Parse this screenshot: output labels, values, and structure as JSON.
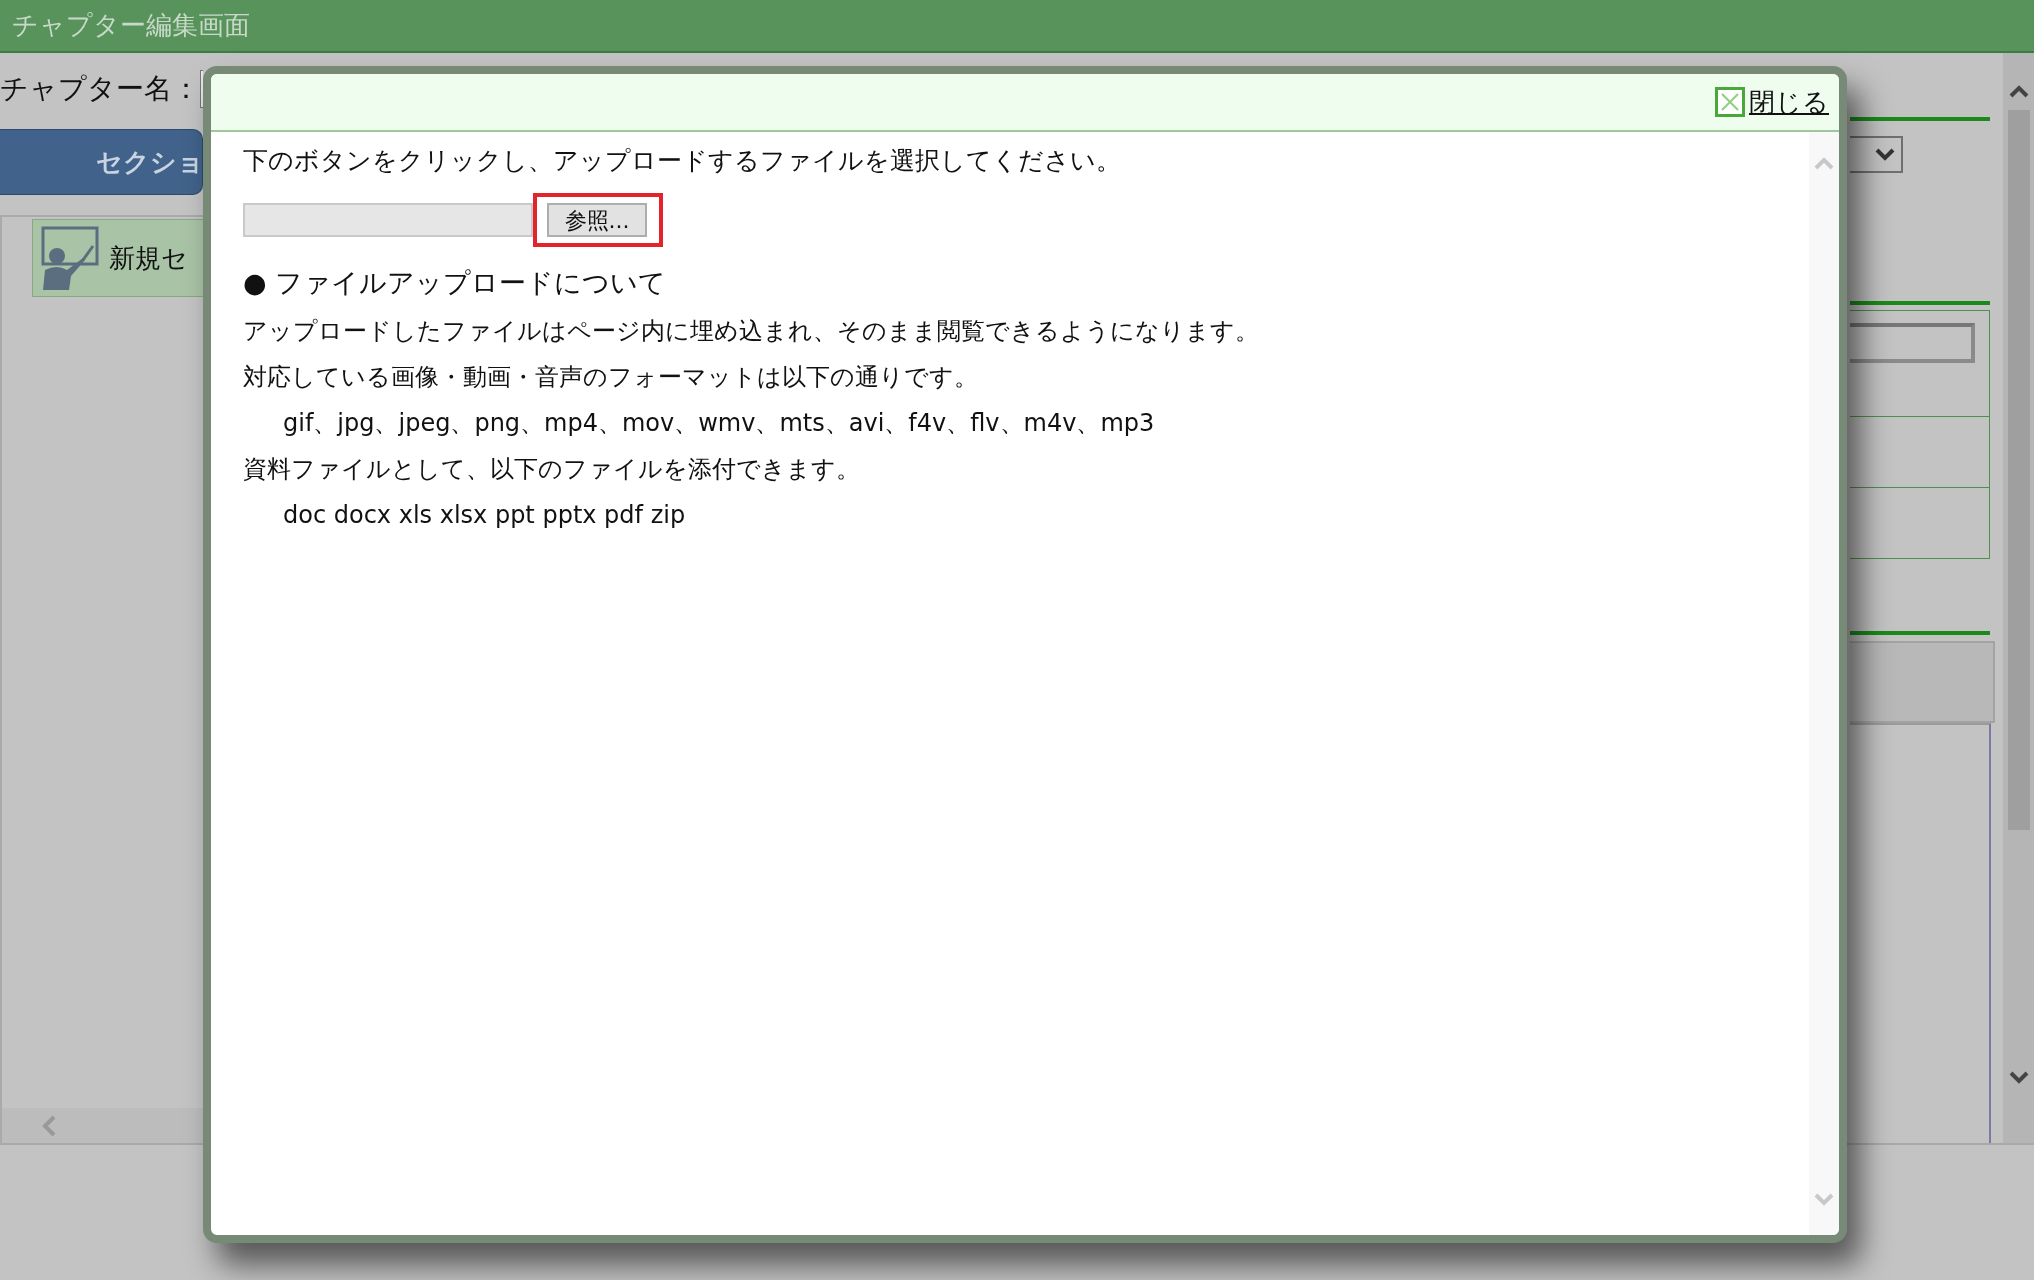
{
  "header": {
    "title": "チャプター編集画面"
  },
  "chapter_name": {
    "label": "チャプター名："
  },
  "section_button": {
    "label": "セクショ"
  },
  "section_items": [
    {
      "label": "新規セ"
    }
  ],
  "dialog": {
    "close_link": "閉じる",
    "instruction": "下のボタンをクリックし、アップロードするファイルを選択してください。",
    "file_field": {
      "button": "参照...",
      "highlighted": true
    },
    "about_heading": "● ファイルアップロードについて",
    "paragraphs": [
      {
        "kind": "text",
        "text": "アップロードしたファイルはページ内に埋め込まれ、そのまま閲覧できるようになります。"
      },
      {
        "kind": "text",
        "text": "対応している画像・動画・音声のフォーマットは以下の通りです。"
      },
      {
        "kind": "indent",
        "text": "gif、jpg、jpeg、png、mp4、mov、wmv、mts、avi、f4v、flv、m4v、mp3"
      },
      {
        "kind": "text",
        "text": "資料ファイルとして、以下のファイルを添付できます。"
      },
      {
        "kind": "indent",
        "text": "doc docx xls xlsx ppt pptx pdf zip"
      }
    ]
  }
}
